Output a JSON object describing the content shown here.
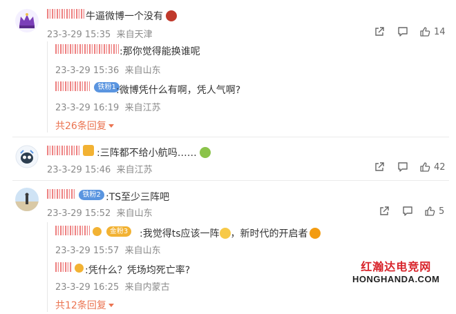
{
  "comments": [
    {
      "text": "牛逼微博一个没有",
      "time": "23-3-29 15:35",
      "source": "来自天津",
      "likes": "14",
      "replies": [
        {
          "text": ":那你觉得能换谁呢",
          "time": "23-3-29 15:36",
          "source": "来自山东"
        },
        {
          "badge": "铁粉1",
          "text": ":微博凭什么有啊，凭人气啊?",
          "time": "23-3-29 16:19",
          "source": "来自江苏"
        }
      ],
      "more": "共26条回复"
    },
    {
      "text": ":三阵都不给小航吗……",
      "time": "23-3-29 15:46",
      "source": "来自江苏",
      "likes": "42"
    },
    {
      "badge": "铁粉2",
      "text": ":TS至少三阵吧",
      "time": "23-3-29 15:52",
      "source": "来自山东",
      "likes": "5",
      "replies": [
        {
          "badge": "金粉3",
          "text": ":我觉得ts应该一阵",
          "text2": "，新时代的开启者",
          "time": "23-3-29 15:57",
          "source": "来自山东"
        },
        {
          "text": ":凭什么？凭场均死亡率?",
          "time": "23-3-29 16:25",
          "source": "来自内蒙古"
        }
      ],
      "more": "共12条回复"
    }
  ],
  "watermark": {
    "line1": "红瀚达电竞网",
    "line2": "HONGHANDA.COM"
  },
  "icons": [
    "share-icon",
    "comment-icon",
    "like-icon",
    "caret-down-icon"
  ],
  "colors": {
    "username": "#ff8200",
    "more_replies": "#eb7350",
    "meta": "#8a8a8a"
  }
}
